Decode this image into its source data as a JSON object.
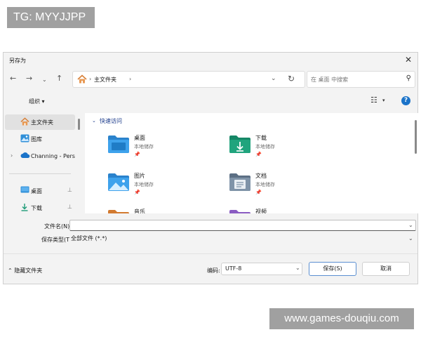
{
  "watermarks": {
    "top_left": "TG: MYYJJPP",
    "bottom_right": "www.games-douqiu.com"
  },
  "dialog": {
    "title": "另存为",
    "close_icon": "close-icon"
  },
  "nav": {
    "back_icon": "arrow-left-icon",
    "forward_icon": "arrow-right-icon",
    "recent_icon": "chevron-down-icon",
    "up_icon": "arrow-up-icon",
    "address": {
      "home_icon": "home-icon",
      "path": "主文件夹",
      "separator": "›"
    },
    "refresh_icon": "refresh-icon",
    "search": {
      "placeholder": "在 桌面 中搜索",
      "icon": "search-icon"
    }
  },
  "toolbar": {
    "organize_label": "组织 ▾",
    "view_icon": "view-list-icon",
    "help_label": "?"
  },
  "sidebar": {
    "items": [
      {
        "label": "主文件夹",
        "icon": "home-icon",
        "selected": true
      },
      {
        "label": "图库",
        "icon": "gallery-icon"
      },
      {
        "label": "Channing - Pers",
        "icon": "cloud-icon",
        "expandable": true
      },
      {
        "label": "桌面",
        "icon": "desktop-icon",
        "pinned": true
      },
      {
        "label": "下载",
        "icon": "download-icon",
        "pinned": true
      }
    ]
  },
  "content": {
    "group_label": "快速访问",
    "tiles": [
      {
        "name": "桌面",
        "subtitle": "本地储存",
        "icon": "desktop-folder-icon",
        "pinned": true
      },
      {
        "name": "下载",
        "subtitle": "本地储存",
        "icon": "downloads-folder-icon",
        "pinned": true
      },
      {
        "name": "图片",
        "subtitle": "本地储存",
        "icon": "pictures-folder-icon",
        "pinned": true
      },
      {
        "name": "文档",
        "subtitle": "本地储存",
        "icon": "documents-folder-icon",
        "pinned": true
      },
      {
        "name": "音乐",
        "icon": "music-folder-icon"
      },
      {
        "name": "视频",
        "icon": "videos-folder-icon"
      }
    ],
    "pin_glyph": "📌"
  },
  "form": {
    "filename_label": "文件名(N):",
    "filename_value": "",
    "filetype_label": "保存类型(T):",
    "filetype_value": "全部文件  (*.*)"
  },
  "footer": {
    "hide_folders_label": "⌃ 隐藏文件夹",
    "encoding_label": "编码:",
    "encoding_value": "UTF-8",
    "save_label": "保存(S)",
    "cancel_label": "取消"
  },
  "colors": {
    "accent": "#1a73c9",
    "folder_blue": "#2f8fd8",
    "folder_green": "#1f9b78",
    "folder_orange": "#e0873a",
    "folder_purple": "#8a5cc2"
  }
}
